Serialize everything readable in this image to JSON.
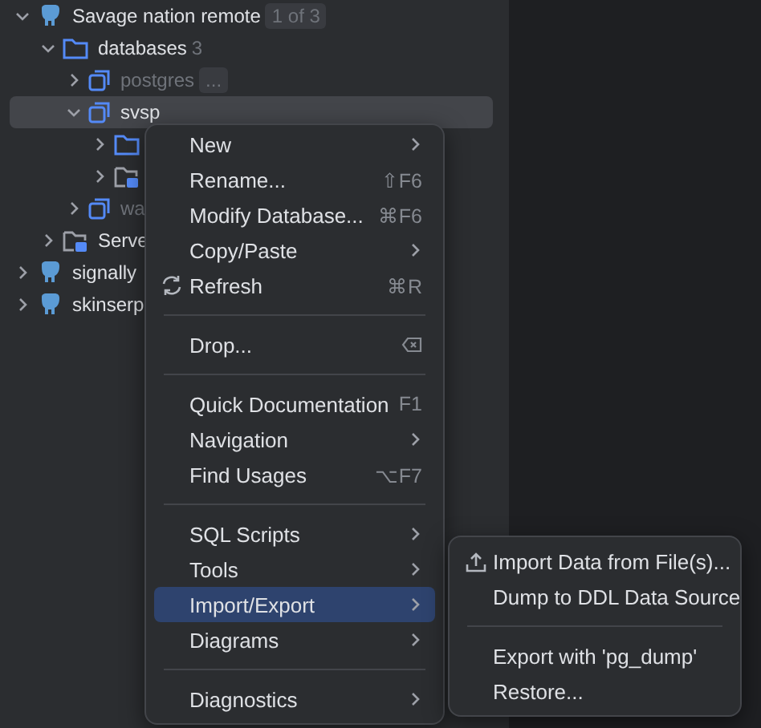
{
  "tree": [
    {
      "label": "Savage nation remote",
      "badge": "1 of 3",
      "kind": "postgres",
      "expanded": true,
      "selected": false,
      "dimmed": false,
      "children": [
        {
          "label": "databases",
          "count": "3",
          "kind": "folder",
          "expanded": true,
          "selected": false,
          "dimmed": false,
          "children": [
            {
              "label": "postgres",
              "badge": "...",
              "kind": "database",
              "expanded": false,
              "selected": false,
              "dimmed": true
            },
            {
              "label": "svsp",
              "kind": "database",
              "expanded": true,
              "selected": true,
              "dimmed": false,
              "children": [
                {
                  "kind": "folder",
                  "expanded": false,
                  "selected": false
                },
                {
                  "kind": "server-folder",
                  "expanded": false,
                  "selected": false
                }
              ]
            },
            {
              "label": "wa",
              "kind": "database",
              "expanded": false,
              "selected": false,
              "dimmed": true
            }
          ]
        },
        {
          "label": "Serve",
          "kind": "server-folder",
          "expanded": false,
          "selected": false,
          "dimmed": false
        }
      ]
    },
    {
      "label": "signally",
      "kind": "postgres",
      "expanded": false,
      "selected": false,
      "dimmed": false
    },
    {
      "label": "skinserp",
      "kind": "postgres",
      "expanded": false,
      "selected": false,
      "dimmed": false
    }
  ],
  "context_menu": [
    {
      "kind": "item",
      "label": "New",
      "submenu": true,
      "selected": false
    },
    {
      "kind": "item",
      "label": "Rename...",
      "shortcut": "⇧F6",
      "submenu": false,
      "selected": false
    },
    {
      "kind": "item",
      "label": "Modify Database...",
      "shortcut": "⌘F6",
      "submenu": false,
      "selected": false
    },
    {
      "kind": "item",
      "label": "Copy/Paste",
      "submenu": true,
      "selected": false
    },
    {
      "kind": "refresh",
      "label": "Refresh",
      "shortcut": "⌘R",
      "submenu": false,
      "selected": false
    },
    {
      "kind": "separator"
    },
    {
      "kind": "delete",
      "label": "Drop...",
      "submenu": false,
      "selected": false
    },
    {
      "kind": "separator"
    },
    {
      "kind": "item",
      "label": "Quick Documentation",
      "shortcut": "F1",
      "submenu": false,
      "selected": false
    },
    {
      "kind": "item",
      "label": "Navigation",
      "submenu": true,
      "selected": false
    },
    {
      "kind": "item",
      "label": "Find Usages",
      "shortcut": "⌥F7",
      "submenu": false,
      "selected": false
    },
    {
      "kind": "separator"
    },
    {
      "kind": "item",
      "label": "SQL Scripts",
      "submenu": true,
      "selected": false
    },
    {
      "kind": "item",
      "label": "Tools",
      "submenu": true,
      "selected": false
    },
    {
      "kind": "item",
      "label": "Import/Export",
      "submenu": true,
      "selected": true
    },
    {
      "kind": "item",
      "label": "Diagrams",
      "submenu": true,
      "selected": false
    },
    {
      "kind": "separator"
    },
    {
      "kind": "item",
      "label": "Diagnostics",
      "submenu": true,
      "selected": false
    }
  ],
  "submenu": [
    {
      "kind": "import",
      "label": "Import Data from File(s)...",
      "selected": false
    },
    {
      "kind": "item",
      "label": "Dump to DDL Data Source",
      "selected": false
    },
    {
      "kind": "separator"
    },
    {
      "kind": "item",
      "label": "Export with 'pg_dump'",
      "selected": false
    },
    {
      "kind": "item",
      "label": "Restore...",
      "selected": false
    }
  ]
}
